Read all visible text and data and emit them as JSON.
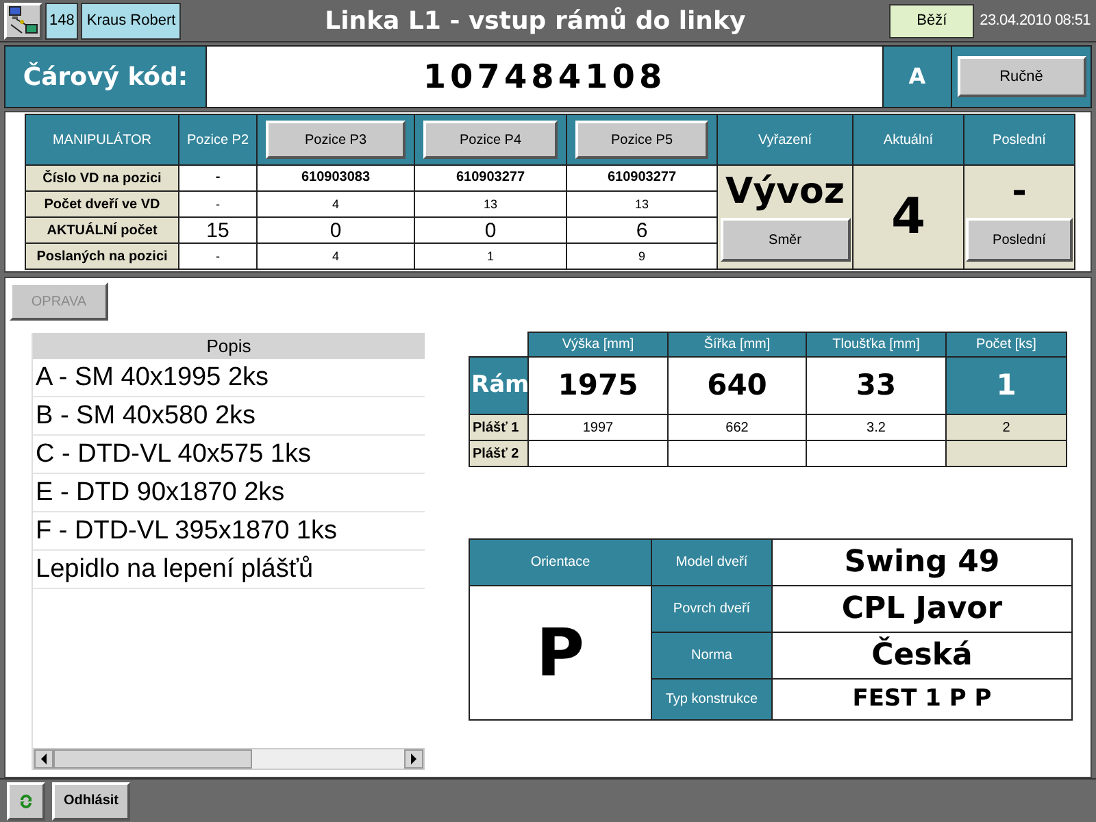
{
  "header": {
    "user_id": "148",
    "user_name": "Kraus Robert",
    "title": "Linka L1 - vstup rámů do linky",
    "status": "Běží",
    "datetime": "23.04.2010 08:51"
  },
  "barcode": {
    "label": "Čárový kód:",
    "value": "107484108",
    "mode": "A",
    "mode_button": "Ručně"
  },
  "manipulator": {
    "corner": "MANIPULÁTOR",
    "positions": [
      {
        "label": "Pozice P2",
        "kind": "header"
      },
      {
        "label": "Pozice P3",
        "kind": "button"
      },
      {
        "label": "Pozice P4",
        "kind": "button"
      },
      {
        "label": "Pozice P5",
        "kind": "button"
      }
    ],
    "rows": [
      {
        "label": "Číslo VD na pozici",
        "kind": "bold",
        "cells": [
          "-",
          "610903083",
          "610903277",
          "610903277"
        ]
      },
      {
        "label": "Počet dveří ve VD",
        "kind": "small",
        "cells": [
          "-",
          "4",
          "13",
          "13"
        ]
      },
      {
        "label": "AKTUÁLNÍ počet",
        "kind": "large",
        "cells": [
          "15",
          "0",
          "0",
          "6"
        ]
      },
      {
        "label": "Poslaných na pozici",
        "kind": "small",
        "cells": [
          "-",
          "4",
          "1",
          "9"
        ]
      }
    ],
    "vyrazeni": {
      "label": "Vyřazení",
      "value": "Vývoz",
      "button": "Směr"
    },
    "aktualni": {
      "label": "Aktuální",
      "value": "4"
    },
    "posledni": {
      "label": "Poslední",
      "value": "-",
      "button": "Poslední"
    }
  },
  "correction_button": {
    "label": "OPRAVA",
    "disabled": true
  },
  "parts_list": {
    "column": "Popis",
    "items": [
      "A - SM 40x1995 2ks",
      "B - SM 40x580 2ks",
      "C - DTD-VL 40x575 1ks",
      "E - DTD 90x1870 2ks",
      "F - DTD-VL 395x1870 1ks",
      "Lepidlo na lepení plášťů"
    ]
  },
  "frame_table": {
    "columns": [
      "Výška [mm]",
      "Šířka [mm]",
      "Tloušťka [mm]",
      "Počet [ks]"
    ],
    "rows": [
      {
        "label": "Rám",
        "kind": "main",
        "cells": [
          "1975",
          "640",
          "33",
          "1"
        ]
      },
      {
        "label": "Plášť 1",
        "kind": "sub",
        "cells": [
          "1997",
          "662",
          "3.2",
          "2"
        ]
      },
      {
        "label": "Plášť 2",
        "kind": "sub",
        "cells": []
      }
    ]
  },
  "door": {
    "orientation_label": "Orientace",
    "orientation": "P",
    "fields": [
      {
        "label": "Model dveří",
        "value": "Swing 49"
      },
      {
        "label": "Povrch dveří",
        "value": "CPL Javor"
      },
      {
        "label": "Norma",
        "value": "Česká"
      },
      {
        "label": "Typ konstrukce",
        "value": "FEST 1 P P"
      }
    ]
  },
  "footer": {
    "logout": "Odhlásit"
  }
}
